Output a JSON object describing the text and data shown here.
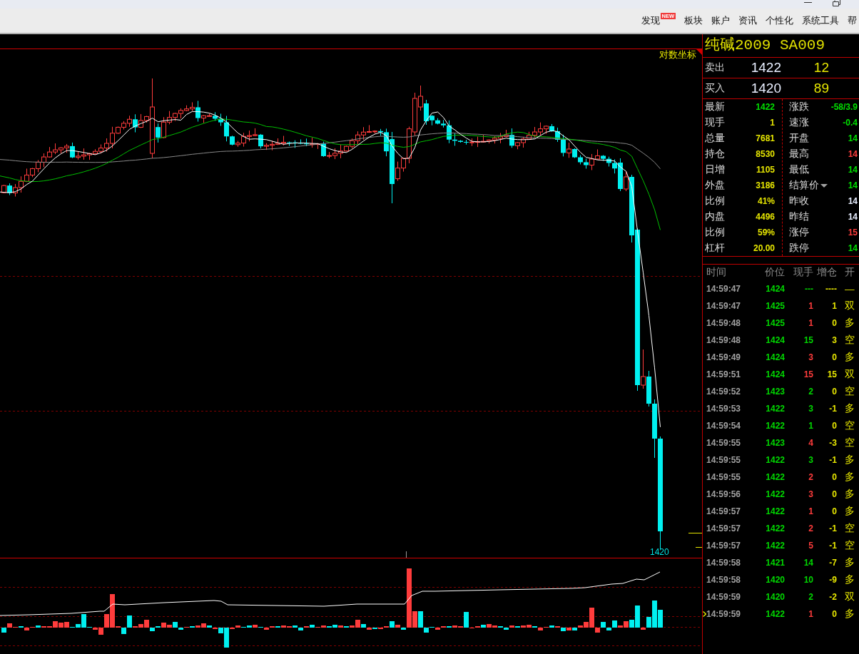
{
  "menu": [
    {
      "label": "发现",
      "badge": "NEW"
    },
    {
      "label": "板块"
    },
    {
      "label": "账户"
    },
    {
      "label": "资讯"
    },
    {
      "label": "个性化"
    },
    {
      "label": "系统工具"
    },
    {
      "label": "帮"
    }
  ],
  "chart": {
    "scale_toggle": "对数坐标",
    "last_price_label": "1420"
  },
  "quote": {
    "title": "纯碱2009 SA009",
    "ask": {
      "label": "卖出",
      "price": "1422",
      "volume": "12"
    },
    "bid": {
      "label": "买入",
      "price": "1420",
      "volume": "89"
    }
  },
  "stats": {
    "left": [
      {
        "label": "最新",
        "value": "1422",
        "color": "#00e000"
      },
      {
        "label": "现手",
        "value": "1",
        "color": "#e6e600"
      },
      {
        "label": "总量",
        "value": "7681",
        "color": "#e6e600"
      },
      {
        "label": "持仓",
        "value": "8530",
        "color": "#e6e600"
      },
      {
        "label": "日增",
        "value": "1105",
        "color": "#e6e600"
      },
      {
        "label": "外盘",
        "value": "3186",
        "color": "#e6e600"
      },
      {
        "label": "比例",
        "value": "41%",
        "color": "#e6e600"
      },
      {
        "label": "内盘",
        "value": "4496",
        "color": "#e6e600"
      },
      {
        "label": "比例",
        "value": "59%",
        "color": "#e6e600"
      },
      {
        "label": "杠杆",
        "value": "20.00",
        "color": "#e6e600"
      }
    ],
    "right": [
      {
        "label": "涨跌",
        "value": "-58/3.9",
        "color": "#00e000",
        "kind": "plain"
      },
      {
        "label": "速涨",
        "value": "-0.4",
        "color": "#00e000",
        "kind": "plain"
      },
      {
        "label": "开盘",
        "value": "14",
        "color": "#00e000",
        "kind": "plain"
      },
      {
        "label": "最高",
        "value": "14",
        "color": "#ff3c3c",
        "kind": "plain"
      },
      {
        "label": "最低",
        "value": "14",
        "color": "#00e000",
        "kind": "plain"
      },
      {
        "label": "结算价",
        "value": "14",
        "color": "#00e000",
        "kind": "dropdown"
      },
      {
        "label": "昨收",
        "value": "14",
        "color": "#e8eeff",
        "kind": "plain"
      },
      {
        "label": "昨结",
        "value": "14",
        "color": "#e8eeff",
        "kind": "plain"
      },
      {
        "label": "涨停",
        "value": "15",
        "color": "#ff3c3c",
        "kind": "plain"
      },
      {
        "label": "跌停",
        "value": "14",
        "color": "#00e000",
        "kind": "plain"
      }
    ]
  },
  "ticks": {
    "columns": [
      "时间",
      "价位",
      "现手",
      "增仓",
      "开"
    ],
    "rows": [
      {
        "time": "14:59:47",
        "price": "1424",
        "volume": "---",
        "color": "#00d800",
        "oi_change": "----",
        "type": "—",
        "selected": false
      },
      {
        "time": "14:59:47",
        "price": "1425",
        "volume": "1",
        "color": "#ff3c3c",
        "oi_change": "1",
        "type": "双",
        "selected": false
      },
      {
        "time": "14:59:48",
        "price": "1425",
        "volume": "1",
        "color": "#ff3c3c",
        "oi_change": "0",
        "type": "多",
        "selected": false
      },
      {
        "time": "14:59:48",
        "price": "1424",
        "volume": "15",
        "color": "#00d800",
        "oi_change": "3",
        "type": "空",
        "selected": false
      },
      {
        "time": "14:59:49",
        "price": "1424",
        "volume": "3",
        "color": "#ff3c3c",
        "oi_change": "0",
        "type": "多",
        "selected": false
      },
      {
        "time": "14:59:51",
        "price": "1424",
        "volume": "15",
        "color": "#ff3c3c",
        "oi_change": "15",
        "type": "双",
        "selected": false
      },
      {
        "time": "14:59:52",
        "price": "1423",
        "volume": "2",
        "color": "#00d800",
        "oi_change": "0",
        "type": "空",
        "selected": false
      },
      {
        "time": "14:59:53",
        "price": "1422",
        "volume": "3",
        "color": "#00d800",
        "oi_change": "-1",
        "type": "多",
        "selected": false
      },
      {
        "time": "14:59:54",
        "price": "1422",
        "volume": "1",
        "color": "#00d800",
        "oi_change": "0",
        "type": "空",
        "selected": false
      },
      {
        "time": "14:59:55",
        "price": "1423",
        "volume": "4",
        "color": "#ff3c3c",
        "oi_change": "-3",
        "type": "空",
        "selected": false
      },
      {
        "time": "14:59:55",
        "price": "1422",
        "volume": "3",
        "color": "#00d800",
        "oi_change": "-1",
        "type": "多",
        "selected": false
      },
      {
        "time": "14:59:55",
        "price": "1422",
        "volume": "2",
        "color": "#ff3c3c",
        "oi_change": "0",
        "type": "多",
        "selected": false
      },
      {
        "time": "14:59:56",
        "price": "1422",
        "volume": "3",
        "color": "#ff3c3c",
        "oi_change": "0",
        "type": "多",
        "selected": false
      },
      {
        "time": "14:59:57",
        "price": "1422",
        "volume": "1",
        "color": "#ff3c3c",
        "oi_change": "0",
        "type": "多",
        "selected": false
      },
      {
        "time": "14:59:57",
        "price": "1422",
        "volume": "2",
        "color": "#ff3c3c",
        "oi_change": "-1",
        "type": "空",
        "selected": false
      },
      {
        "time": "14:59:57",
        "price": "1422",
        "volume": "5",
        "color": "#ff3c3c",
        "oi_change": "-1",
        "type": "空",
        "selected": false
      },
      {
        "time": "14:59:58",
        "price": "1421",
        "volume": "14",
        "color": "#00d800",
        "oi_change": "-7",
        "type": "多",
        "selected": false
      },
      {
        "time": "14:59:58",
        "price": "1420",
        "volume": "10",
        "color": "#00d800",
        "oi_change": "-9",
        "type": "多",
        "selected": false
      },
      {
        "time": "14:59:59",
        "price": "1420",
        "volume": "2",
        "color": "#00d800",
        "oi_change": "-2",
        "type": "双",
        "selected": false
      },
      {
        "time": "14:59:59",
        "price": "1422",
        "volume": "1",
        "color": "#ff3c3c",
        "oi_change": "0",
        "type": "多",
        "selected": true
      }
    ]
  }
}
